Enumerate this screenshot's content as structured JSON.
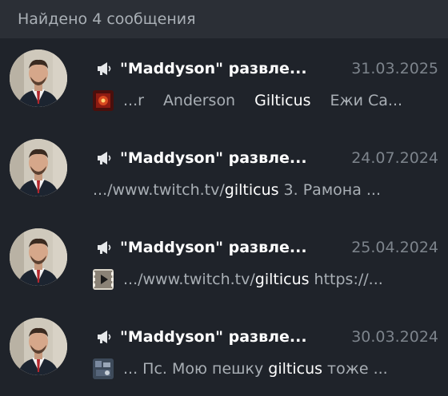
{
  "header": {
    "title": "Найдено 4 сообщения"
  },
  "results": [
    {
      "channel": "\"Maddyson\" развле...",
      "date": "31.03.2025",
      "thumb": "album-cover-red",
      "snippet": [
        "...r",
        "Anderson",
        "Gilticus",
        "Ежи Са..."
      ]
    },
    {
      "channel": "\"Maddyson\" развле...",
      "date": "24.07.2024",
      "pre": ".../www.twitch.tv/",
      "match": "gilticus",
      "post": " 3. Рамона ..."
    },
    {
      "channel": "\"Maddyson\" развле...",
      "date": "25.04.2024",
      "thumb": "video-play",
      "pre": ".../www.twitch.tv/",
      "match": "gilticus",
      "post": " https://..."
    },
    {
      "channel": "\"Maddyson\" развле...",
      "date": "30.03.2024",
      "thumb": "photo-thumbnail",
      "pre": "... Пс. Мою пешку ",
      "match": "gilticus",
      "post": " тоже ..."
    }
  ],
  "colors": {
    "background": "#1f232a",
    "header": "#2b2f36",
    "date": "#7d848c",
    "snippet": "#a9afb5",
    "highlight": "#ffffff"
  }
}
